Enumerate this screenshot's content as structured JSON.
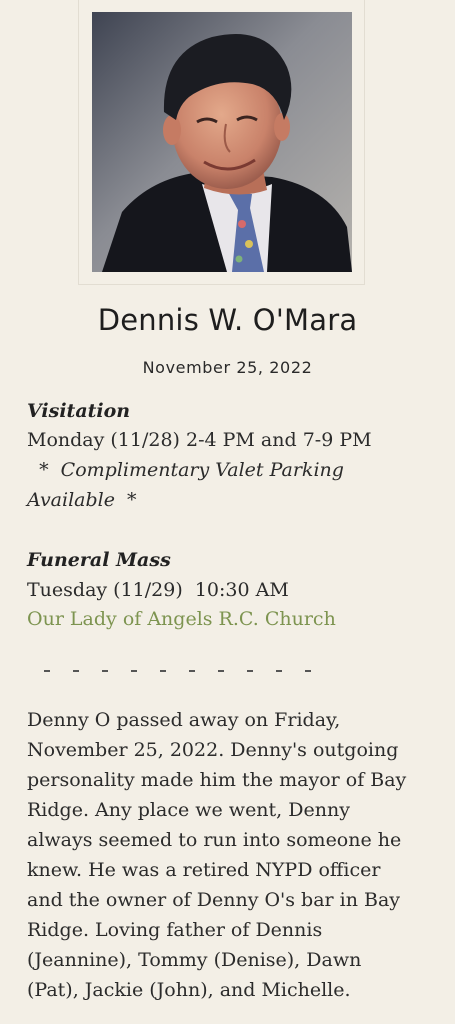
{
  "obituary": {
    "photo_alt": "Portrait of Dennis W. O'Mara",
    "name": "Dennis W. O'Mara",
    "date": "November 25, 2022"
  },
  "visitation": {
    "heading": "Visitation",
    "schedule": "Monday (11/28)  2-4 PM and 7-9 PM",
    "note_line1": "  *  Complimentary Valet Parking",
    "note_line2": "Available  *"
  },
  "funeral": {
    "heading": "Funeral Mass",
    "schedule": "Tuesday (11/29)  10:30 AM",
    "location": "Our Lady of Angels R.C. Church"
  },
  "story": {
    "lines": [
      "Denny O passed away on Friday,",
      "November 25, 2022. Denny's outgoing",
      "personality made him the mayor of Bay",
      "Ridge. Any place we went, Denny",
      "always seemed to run into someone he",
      "knew. He was a retired NYPD officer",
      "and the owner of Denny O's bar in Bay",
      "Ridge. Loving father of Dennis",
      "(Jeannine), Tommy (Denise), Dawn",
      "(Pat), Jackie (John), and Michelle."
    ]
  }
}
